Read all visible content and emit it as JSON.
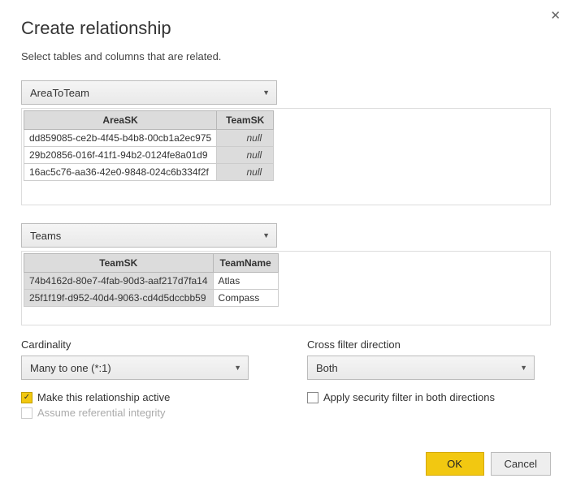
{
  "dialog": {
    "title": "Create relationship",
    "subtitle": "Select tables and columns that are related.",
    "close_glyph": "✕"
  },
  "table1": {
    "selected": "AreaToTeam",
    "columns": [
      "AreaSK",
      "TeamSK"
    ],
    "rows": [
      {
        "c0": "dd859085-ce2b-4f45-b4b8-00cb1a2ec975",
        "c1": "null"
      },
      {
        "c0": "29b20856-016f-41f1-94b2-0124fe8a01d9",
        "c1": "null"
      },
      {
        "c0": "16ac5c76-aa36-42e0-9848-024c6b334f2f",
        "c1": "null"
      }
    ]
  },
  "table2": {
    "selected": "Teams",
    "columns": [
      "TeamSK",
      "TeamName"
    ],
    "rows": [
      {
        "c0": "74b4162d-80e7-4fab-90d3-aaf217d7fa14",
        "c1": "Atlas"
      },
      {
        "c0": "25f1f19f-d952-40d4-9063-cd4d5dccbb59",
        "c1": "Compass"
      }
    ]
  },
  "cardinality": {
    "label": "Cardinality",
    "value": "Many to one (*:1)"
  },
  "crossfilter": {
    "label": "Cross filter direction",
    "value": "Both"
  },
  "checkboxes": {
    "active": "Make this relationship active",
    "security": "Apply security filter in both directions",
    "referential": "Assume referential integrity"
  },
  "buttons": {
    "ok": "OK",
    "cancel": "Cancel"
  }
}
